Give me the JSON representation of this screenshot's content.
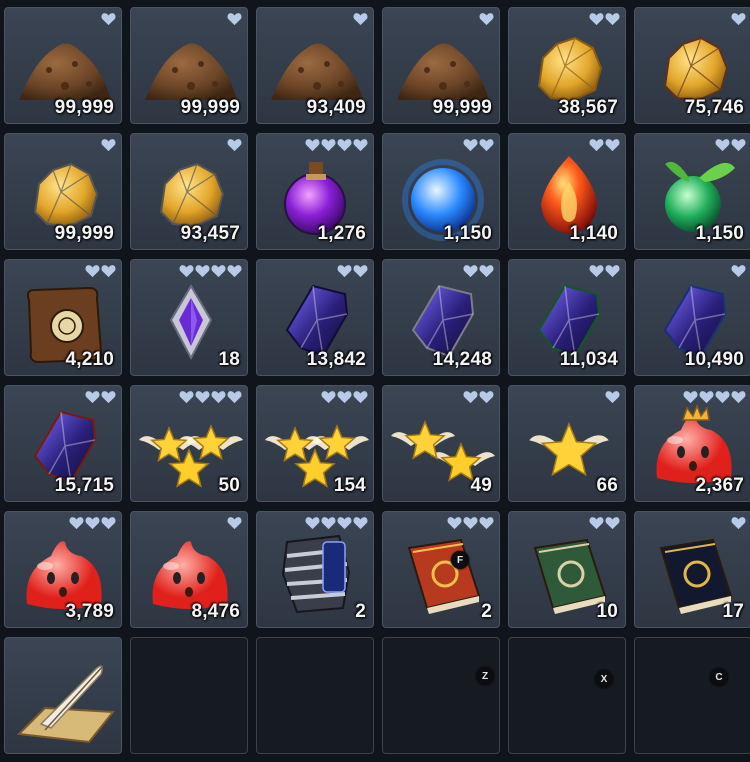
{
  "inventory": {
    "slots": [
      {
        "icon": "dirt-pile-icon",
        "count": "99,999",
        "hearts": 1
      },
      {
        "icon": "dirt-pile-icon",
        "count": "99,999",
        "hearts": 1
      },
      {
        "icon": "dirt-pile-icon",
        "count": "93,409",
        "hearts": 1
      },
      {
        "icon": "dirt-pile-icon",
        "count": "99,999",
        "hearts": 1
      },
      {
        "icon": "gold-ore-icon",
        "count": "38,567",
        "hearts": 2
      },
      {
        "icon": "copper-ore-icon",
        "count": "75,746",
        "hearts": 1
      },
      {
        "icon": "silver-ore-icon",
        "count": "99,999",
        "hearts": 1
      },
      {
        "icon": "silver-ore-icon",
        "count": "93,457",
        "hearts": 1
      },
      {
        "icon": "purple-potion-icon",
        "count": "1,276",
        "hearts": 4
      },
      {
        "icon": "water-orb-icon",
        "count": "1,150",
        "hearts": 2
      },
      {
        "icon": "fire-crystal-icon",
        "count": "1,140",
        "hearts": 2
      },
      {
        "icon": "nature-orb-icon",
        "count": "1,150",
        "hearts": 2
      },
      {
        "icon": "scroll-icon",
        "count": "4,210",
        "hearts": 2
      },
      {
        "icon": "amulet-icon",
        "count": "18",
        "hearts": 4
      },
      {
        "icon": "dark-crystal-icon",
        "count": "13,842",
        "hearts": 2
      },
      {
        "icon": "white-crystal-icon",
        "count": "14,248",
        "hearts": 2
      },
      {
        "icon": "green-crystal-icon",
        "count": "11,034",
        "hearts": 2
      },
      {
        "icon": "blue-crystal-icon",
        "count": "10,490",
        "hearts": 1
      },
      {
        "icon": "orange-crystal-icon",
        "count": "15,715",
        "hearts": 2
      },
      {
        "icon": "triple-star-icon",
        "count": "50",
        "hearts": 4
      },
      {
        "icon": "triple-star-icon",
        "count": "154",
        "hearts": 3
      },
      {
        "icon": "double-star-icon",
        "count": "49",
        "hearts": 2
      },
      {
        "icon": "single-star-icon",
        "count": "66",
        "hearts": 1
      },
      {
        "icon": "red-slime-icon",
        "count": "2,367",
        "hearts": 4
      },
      {
        "icon": "blue-slime-icon",
        "count": "3,789",
        "hearts": 3
      },
      {
        "icon": "gold-slime-icon",
        "count": "8,476",
        "hearts": 1
      },
      {
        "icon": "gauntlet-icon",
        "count": "2",
        "hearts": 4
      },
      {
        "icon": "red-book-icon",
        "count": "2",
        "hearts": 3
      },
      {
        "icon": "green-book-icon",
        "count": "10",
        "hearts": 2
      },
      {
        "icon": "dark-book-icon",
        "count": "17",
        "hearts": 1
      },
      {
        "icon": "quill-letter-icon",
        "count": "",
        "hearts": 0
      },
      {
        "icon": "",
        "count": "",
        "hearts": 0
      },
      {
        "icon": "",
        "count": "",
        "hearts": 0
      },
      {
        "icon": "",
        "count": "",
        "hearts": 0
      },
      {
        "icon": "",
        "count": "",
        "hearts": 0
      },
      {
        "icon": "",
        "count": "",
        "hearts": 0
      }
    ],
    "hotkeys": [
      "F",
      "Z",
      "X",
      "C"
    ]
  },
  "colors": {
    "heart": "#b7cbe9",
    "slot_bg": "#353e4b",
    "empty_bg": "#161b22",
    "page_bg": "#10151c"
  }
}
